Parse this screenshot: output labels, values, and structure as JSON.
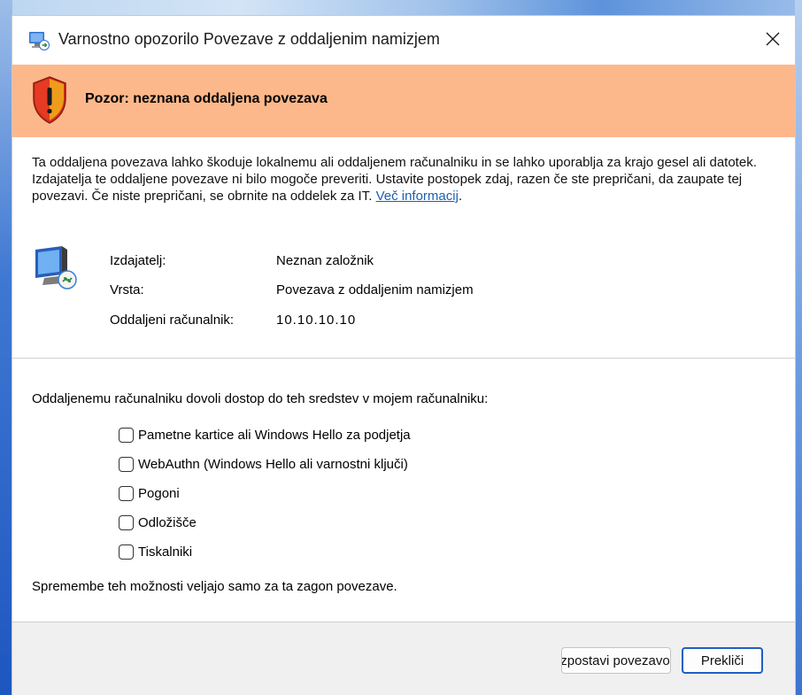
{
  "window": {
    "title": "Varnostno opozorilo Povezave z oddaljenim namizjem",
    "close_symbol": "✕"
  },
  "warning": {
    "heading": "Pozor: neznana oddaljena povezava",
    "band_color": "#fcb88a"
  },
  "description": {
    "text": "Ta oddaljena povezava lahko škoduje lokalnemu ali oddaljenem računalniku in se lahko uporablja za krajo gesel ali datotek. Izdajatelja te oddaljene povezave ni bilo mogoče preveriti. Ustavite postopek zdaj, razen če ste prepričani, da zaupate tej povezavi. Če niste prepričani, se obrnite na oddelek za IT. ",
    "link_text": "Več informacij",
    "link_suffix": "."
  },
  "details": [
    {
      "label": "Izdajatelj:",
      "value": "Neznan založnik"
    },
    {
      "label": "Vrsta:",
      "value": "Povezava z oddaljenim namizjem"
    },
    {
      "label": "Oddaljeni računalnik:",
      "value": "10.10.10.10"
    }
  ],
  "resources": {
    "prompt": "Oddaljenemu računalniku dovoli dostop do teh sredstev v mojem računalniku:",
    "items": [
      {
        "label": "Pametne kartice ali Windows Hello za podjetja",
        "checked": false
      },
      {
        "label": "WebAuthn (Windows Hello ali varnostni ključi)",
        "checked": false
      },
      {
        "label": "Pogoni",
        "checked": false
      },
      {
        "label": "Odložišče",
        "checked": false
      },
      {
        "label": "Tiskalniki",
        "checked": false
      }
    ],
    "note": "Spremembe teh možnosti veljajo samo za ta zagon povezave."
  },
  "buttons": {
    "connect_label": "Vzpostavi povezavo",
    "cancel_label": "Prekliči",
    "accent": "#1f5fc4"
  },
  "icons": {
    "title": "remote-desktop-icon",
    "shield": "warning-shield-icon",
    "monitor": "remote-computer-icon",
    "close": "close-icon"
  }
}
